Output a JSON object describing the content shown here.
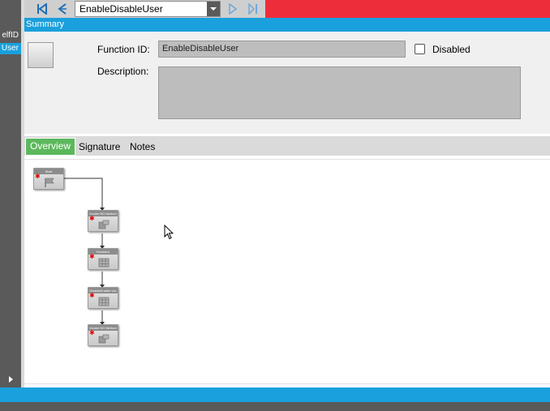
{
  "left_gutter": {
    "items": [
      "elfID",
      "User"
    ],
    "selected_index": 1
  },
  "toolbar": {
    "first_icon": "first-record-icon",
    "prev_icon": "previous-icon",
    "function_select": {
      "value": "EnableDisableUser"
    },
    "next_icon": "next-icon",
    "last_icon": "last-record-icon",
    "accent_color": "#ee2d3a"
  },
  "summary": {
    "header": "Summary",
    "function_id_label": "Function ID:",
    "function_id_value": "EnableDisableUser",
    "disabled_label": "Disabled",
    "disabled_checked": false,
    "description_label": "Description:",
    "description_value": ""
  },
  "tabs": [
    {
      "label": "Overview",
      "active": true
    },
    {
      "label": "Signature",
      "active": false
    },
    {
      "label": "Notes",
      "active": false
    }
  ],
  "flow": {
    "nodes": [
      {
        "title": "Start",
        "icon": "flag-icon"
      },
      {
        "title": "Invoke BO Method",
        "icon": "invoke-method-icon"
      },
      {
        "title": "RowMod",
        "icon": "table-icon"
      },
      {
        "title": "DisableEnable Usr",
        "icon": "table-icon"
      },
      {
        "title": "Invoke BO Method",
        "icon": "invoke-method-icon"
      }
    ]
  },
  "colors": {
    "header_blue": "#1aa0dc",
    "active_tab_green": "#5cb85c"
  }
}
